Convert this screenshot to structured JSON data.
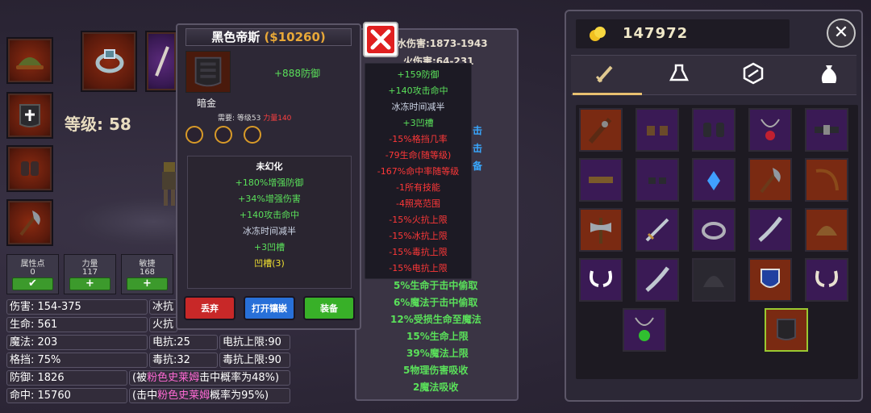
{
  "character": {
    "level_label": "等级: 58",
    "attributes": [
      {
        "label": "属性点",
        "value": "0",
        "button": "✔"
      },
      {
        "label": "力量",
        "value": "117",
        "button": "+"
      },
      {
        "label": "敏捷",
        "value": "168",
        "button": "+"
      }
    ],
    "stats_left": [
      {
        "label": "伤害: 154-375"
      },
      {
        "label": "生命: 561"
      },
      {
        "label": "魔法: 203"
      },
      {
        "label": "格挡: 75%"
      },
      {
        "label": "防御: 1826"
      },
      {
        "label": "命中: 15760"
      }
    ],
    "stats_mid": [
      {
        "label": "冰抗"
      },
      {
        "label": "火抗"
      },
      {
        "label": "电抗:25"
      },
      {
        "label": "毒抗:32"
      }
    ],
    "stats_right": [
      {
        "label": "电抗上限:90"
      },
      {
        "label": "毒抗上限:90"
      }
    ],
    "slime_block": {
      "prefix": "(被",
      "name": "粉色史莱姆",
      "suffix": "击中概率为48%)"
    },
    "slime_hit": {
      "prefix": "(击中",
      "name": "粉色史莱姆",
      "suffix": "概率为95%)"
    }
  },
  "item_detail": {
    "name": "黑色帝斯",
    "price": "($10260)",
    "quality": "暗金",
    "main_stat": "+888防御",
    "req_prefix": "需要: 等级53",
    "req_str": "力量140",
    "unfused_title": "未幻化",
    "bonuses": [
      {
        "text": "+180%增强防御",
        "color": "g"
      },
      {
        "text": "+34%增强伤害",
        "color": "g"
      },
      {
        "text": "+140攻击命中",
        "color": "g"
      },
      {
        "text": "冰冻时间减半",
        "color": "w"
      },
      {
        "text": "+3凹槽",
        "color": "g"
      },
      {
        "text": "凹槽(3)",
        "color": "y"
      }
    ],
    "buttons": {
      "discard": "丢弃",
      "open_socket": "打开镶嵌",
      "equip": "装备"
    }
  },
  "compare_panel": {
    "top_lines": [
      "水伤害:1873-1943",
      "火伤害:64-231"
    ],
    "side_lines": [
      "击",
      "击",
      "备"
    ],
    "bottom_lines": [
      "5%生命于击中偷取",
      "6%魔法于击中偷取",
      "12%受损生命至魔法",
      "15%生命上限",
      "39%魔法上限",
      "5物理伤害吸收",
      "2魔法吸收"
    ]
  },
  "tooltip": {
    "lines": [
      {
        "text": "+159防御",
        "color": "g"
      },
      {
        "text": "+140攻击命中",
        "color": "g"
      },
      {
        "text": "冰冻时间减半",
        "color": "w"
      },
      {
        "text": "+3凹槽",
        "color": "g"
      },
      {
        "text": "-15%格挡几率",
        "color": "r"
      },
      {
        "text": "-79生命(随等级)",
        "color": "r"
      },
      {
        "text": "-167%命中率随等级",
        "color": "r"
      },
      {
        "text": "-1所有技能",
        "color": "r"
      },
      {
        "text": "-4照亮范围",
        "color": "r"
      },
      {
        "text": "-15%火抗上限",
        "color": "r"
      },
      {
        "text": "-15%冰抗上限",
        "color": "r"
      },
      {
        "text": "-15%毒抗上限",
        "color": "r"
      },
      {
        "text": "-15%电抗上限",
        "color": "r"
      }
    ]
  },
  "inventory": {
    "gold": "147972",
    "close": "✕",
    "tabs": [
      "weapon-tab-icon",
      "potion-tab-icon",
      "gem-tab-icon",
      "bag-tab-icon"
    ],
    "items": [
      "spiked-club-icon",
      "boots-icon",
      "gloves-icon",
      "amulet-icon",
      "belt-icon",
      "belt-icon",
      "boots-icon",
      "crystal-icon",
      "axe-icon",
      "bow-icon",
      "double-axe-icon",
      "sword-icon",
      "ring-icon",
      "scimitar-icon",
      "helmet-icon",
      "horns-icon",
      "scimitar-icon",
      "dark-helmet-icon",
      "shield-icon",
      "horns-icon",
      "green-amulet-icon",
      "armor-icon"
    ]
  }
}
